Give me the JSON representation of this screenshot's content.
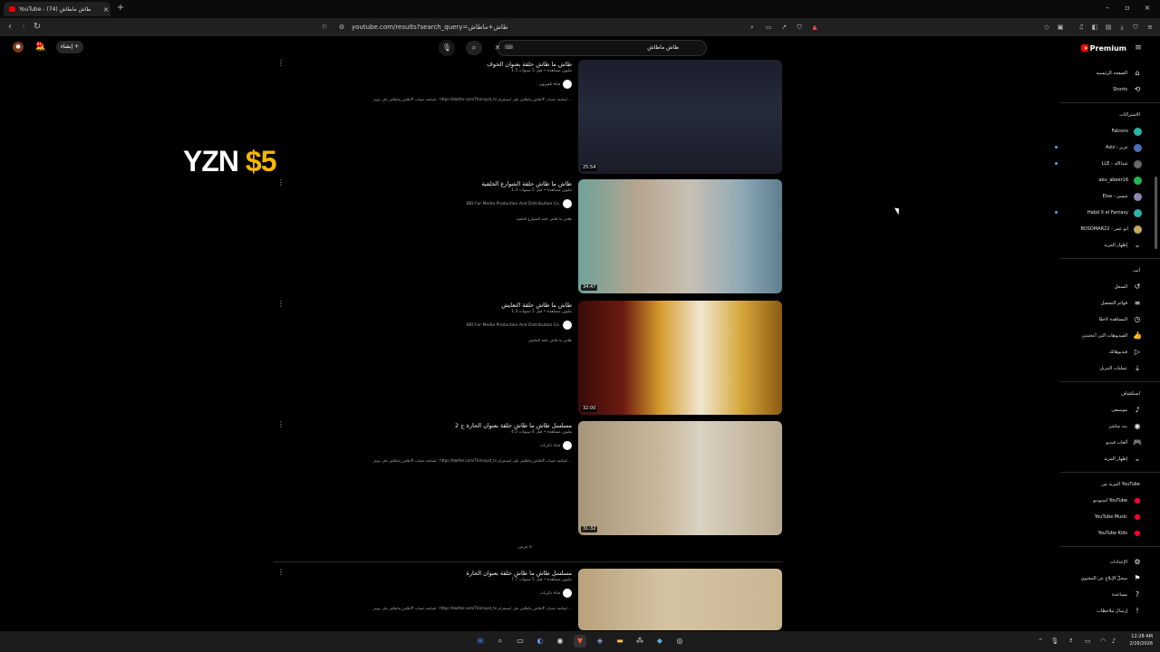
{
  "browser": {
    "tab_title": "YouTube - طاش ماطاش (74)",
    "tab_close": "×",
    "new_tab": "+",
    "url": "youtube.com/results?search_query=طاش+ماطاش",
    "win_min": "–",
    "win_max": "▫",
    "win_close": "×"
  },
  "masthead": {
    "logo_text": "Premium",
    "search_query": "طاش ماطاش",
    "create_label": "إنشاء",
    "notif_count": "9+"
  },
  "sidebar": {
    "main": [
      {
        "label": "الصفحة الرئيسية",
        "icon": "home-icon",
        "glyph": "⌂"
      },
      {
        "label": "Shorts",
        "icon": "shorts-icon",
        "glyph": "⟲"
      }
    ],
    "subs_heading": "الاشتراكات",
    "subs": [
      {
        "label": "Falcons",
        "color": "#2bb5a8",
        "dot": false
      },
      {
        "label": "Aziz - عزيز",
        "color": "#4a6fb5",
        "dot": true
      },
      {
        "label": "LLE - عبدالاله",
        "color": "#6a6a6a",
        "dot": true
      },
      {
        "label": "abu_abeer16",
        "color": "#1db954",
        "dot": false
      },
      {
        "label": "Eisa - عيسى",
        "color": "#8a8ab0",
        "dot": false
      },
      {
        "label": "Habd X el Fantasy",
        "color": "#2bb5a8",
        "dot": true
      },
      {
        "label": "BOSOMAR22 - ابو عمر",
        "color": "#c9a860",
        "dot": false
      },
      {
        "label": "إظهار المزيد",
        "color": "",
        "dot": false
      }
    ],
    "you_heading": "أنت",
    "you": [
      {
        "label": "السجل",
        "glyph": "↺",
        "icon": "history-icon"
      },
      {
        "label": "قوائم التشغيل",
        "glyph": "≡",
        "icon": "playlists-icon"
      },
      {
        "label": "المشاهدة لاحقًا",
        "glyph": "◷",
        "icon": "watch-later-icon"
      },
      {
        "label": "الفيديوهات التي أعجبتني",
        "glyph": "👍",
        "icon": "liked-icon"
      },
      {
        "label": "فيديوهاتك",
        "glyph": "▷",
        "icon": "your-videos-icon"
      },
      {
        "label": "عمليات التنزيل",
        "glyph": "⤓",
        "icon": "downloads-icon"
      }
    ],
    "explore_heading": "استكشاف",
    "explore": [
      {
        "label": "موسيقى",
        "glyph": "♪",
        "icon": "music-icon"
      },
      {
        "label": "بث مباشر",
        "glyph": "◉",
        "icon": "live-icon"
      },
      {
        "label": "ألعاب فيديو",
        "glyph": "🎮",
        "icon": "gaming-icon"
      },
      {
        "label": "إظهار المزيد",
        "glyph": "⌄",
        "icon": "chevron-down-icon"
      }
    ],
    "more_heading": "المزيد من YouTube",
    "more": [
      {
        "label": "استوديو YouTube",
        "glyph": "●",
        "icon": "studio-icon"
      },
      {
        "label": "YouTube Music",
        "glyph": "●",
        "icon": "yt-music-icon"
      },
      {
        "label": "YouTube Kids",
        "glyph": "●",
        "icon": "yt-kids-icon"
      }
    ],
    "settings": [
      {
        "label": "الإعدادات",
        "glyph": "⚙",
        "icon": "settings-icon"
      },
      {
        "label": "سجلّ الإبلاغ عن المحتوى",
        "glyph": "⚑",
        "icon": "flag-icon"
      },
      {
        "label": "مساعدة",
        "glyph": "?",
        "icon": "help-icon"
      },
      {
        "label": "إرسال ملاحظات",
        "glyph": "!",
        "icon": "feedback-icon"
      }
    ]
  },
  "results": [
    {
      "title": "طاش ما طاش حلقة بعنوان الخوف",
      "meta": "1.5 مليون مشاهدة • قبل 5 سنوات",
      "channel": "قناة تلفزيون",
      "desc": "لمتابعة حساب #طاش_ماطاش على تويتر : https://twitter.com/Thikrayat_tv لمتابعة حساب #طاش_ماطاش على انستقرام ...",
      "duration": "25:54",
      "bg": "linear-gradient(180deg,#1c1e2c 0%,#262b3a 45%,#1a1c28 100%)"
    },
    {
      "title": "طاش ما طاش حلقة الشوارع الخلفية",
      "meta": "1.3 مليون مشاهدة • قبل 5 سنوات",
      "channel": "IBD For Media Production And Distribution Co.",
      "desc": "طاش ما طاش حلقة الشوارع الخلفية",
      "duration": "34:47",
      "bg": "linear-gradient(90deg,#6fa19a 0%,#b7a58f 30%,#c8c0b4 55%,#8fa9b6 80%,#5e7f8e 100%)"
    },
    {
      "title": "طاش ما طاش حلقة التعايش",
      "meta": "1.3 مليون مشاهدة • قبل 5 سنوات",
      "channel": "IBD For Media Production And Distribution Co.",
      "desc": "طاش ما طاش حلقة التعايش",
      "duration": "32:00",
      "bg": "linear-gradient(90deg,#3a0b08 0%,#6b1a10 22%,#d59a2c 40%,#efe6d2 60%,#d6a83a 80%,#8a5a12 100%)"
    },
    {
      "title": "مسلسل طاش ما طاش حلقة بعنوان الحارة ج 2",
      "meta": "4.2 مليون مشاهدة • قبل 4 سنوات",
      "channel": "قناة ذكريات",
      "desc": "لمتابعة حساب #طاش_ماطاش على تويتر : https://twitter.com/Thikrayat_tv لمتابعة حساب #طاش_ماطاش على انستقرام ...",
      "duration": "31:32",
      "bg": "linear-gradient(90deg,#a7977a 0%,#c8b79a 40%,#d9d1c2 60%,#b7a98e 100%)"
    },
    {
      "title": "مسلسل طاش ما طاش حلقة بعنوان الحارة",
      "meta": "7.7 مليون مشاهدة • قبل 5 سنوات",
      "channel": "قناة ذكريات",
      "desc": "لمتابعة حساب #طاش_ماطاش على تويتر : https://twitter.com/Thikrayat_tv لمتابعة حساب #طاش_ماطاش على انستقرام ...",
      "duration": "",
      "bg": "linear-gradient(90deg,#b9a27c 0%,#d4c3a2 45%,#c9b693 100%)"
    }
  ],
  "more_label": "٥٠ عرض",
  "overlay": {
    "word": "YZN",
    "price": "$5"
  },
  "taskbar": {
    "time": "12:28 AM",
    "date": "2/16/2026",
    "lang": "E"
  }
}
